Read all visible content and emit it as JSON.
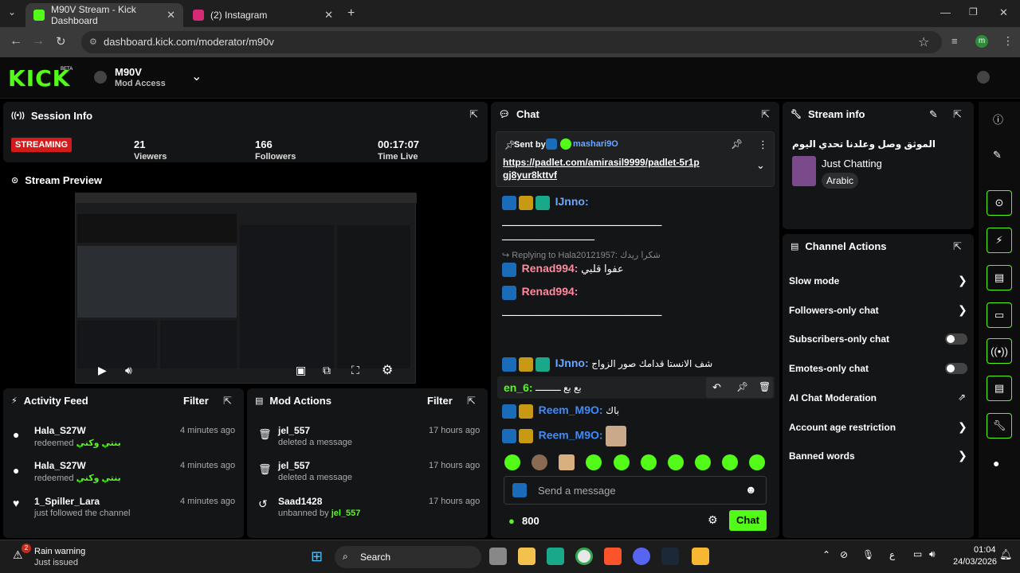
{
  "browser": {
    "tabs": [
      {
        "label": "M90V Stream - Kick Dashboard",
        "active": true
      },
      {
        "label": "(2) Instagram",
        "active": false
      }
    ],
    "url": "dashboard.kick.com/moderator/m90v",
    "profile_initial": "m"
  },
  "header": {
    "logo": "KICK",
    "logo_badge": "BETA",
    "channel_name": "M90V",
    "role": "Mod Access"
  },
  "session_info": {
    "title": "Session Info",
    "status": "STREAMING",
    "viewers": "21",
    "viewers_label": "Viewers",
    "followers": "166",
    "followers_label": "Followers",
    "time_live": "00:17:07",
    "time_label": "Time Live"
  },
  "stream_preview": {
    "title": "Stream Preview"
  },
  "activity_feed": {
    "title": "Activity Feed",
    "filter": "Filter",
    "items": [
      {
        "user": "Hala_S27W",
        "action": "redeemed",
        "reward": "بنتي وكني",
        "time": "4 minutes ago"
      },
      {
        "user": "Hala_S27W",
        "action": "redeemed",
        "reward": "بنتي وكني",
        "time": "4 minutes ago"
      },
      {
        "user": "1_Spiller_Lara",
        "action": "just followed the channel",
        "reward": "",
        "time": "4 minutes ago"
      }
    ]
  },
  "mod_actions": {
    "title": "Mod Actions",
    "filter": "Filter",
    "items": [
      {
        "user": "jel_557",
        "action": "deleted a message",
        "by": "",
        "time": "17 hours ago"
      },
      {
        "user": "jel_557",
        "action": "deleted a message",
        "by": "",
        "time": "17 hours ago"
      },
      {
        "user": "Saad1428",
        "action": "unbanned by",
        "by": "jel_557",
        "time": "17 hours ago"
      }
    ]
  },
  "chat": {
    "title": "Chat",
    "pinned": {
      "sent_by_label": "Sent by",
      "user": "mashari9O",
      "link": "https://padlet.com/amirasil9999/padlet-5r1pgj8yur8kttvf"
    },
    "messages": [
      {
        "user": "IJnno:",
        "text": "ـــــــــــــــــــــــــــــــــــــــــــــــــــــــــ",
        "text2": "ـــــــــــــــــــــــــــــــــ"
      },
      {
        "reply": "Replying to Hala20121957:",
        "reply_text": "شكرا ريدك"
      },
      {
        "user": "Renad994:",
        "text": "عفوا قلبي"
      },
      {
        "user": "Renad994:",
        "text": "ـــــــــــــــــــــــــــــــــــــــــــــــــــــــــ"
      },
      {
        "user": "IJnno:",
        "text": "شف الانستا قدامك صور الزواج"
      },
      {
        "user": "en_6:",
        "text": "بع بع ـــــــــ"
      },
      {
        "user": "Reem_M9O:",
        "text": "باك"
      },
      {
        "user": "Reem_M9O:",
        "text": ""
      }
    ],
    "input_placeholder": "Send a message",
    "points": "800",
    "send_label": "Chat"
  },
  "stream_info": {
    "title": "Stream info",
    "stream_title": "الموثق وصل وعلدنا تحدي اليوم",
    "category": "Just Chatting",
    "language": "Arabic"
  },
  "channel_actions": {
    "title": "Channel Actions",
    "items": [
      {
        "label": "Slow mode",
        "control": "chevron"
      },
      {
        "label": "Followers-only chat",
        "control": "chevron"
      },
      {
        "label": "Subscribers-only chat",
        "control": "toggle"
      },
      {
        "label": "Emotes-only chat",
        "control": "toggle"
      },
      {
        "label": "AI Chat Moderation",
        "control": "external"
      },
      {
        "label": "Account age restriction",
        "control": "chevron"
      },
      {
        "label": "Banned words",
        "control": "chevron"
      }
    ]
  },
  "taskbar": {
    "weather_title": "Rain warning",
    "weather_sub": "Just issued",
    "weather_badge": "2",
    "search": "Search",
    "lang": "ع",
    "time": "01:04",
    "date": "24/03/2026"
  },
  "colors": {
    "accent": "#53fc18",
    "panel": "#141517",
    "mod": "#1a6bb8"
  }
}
